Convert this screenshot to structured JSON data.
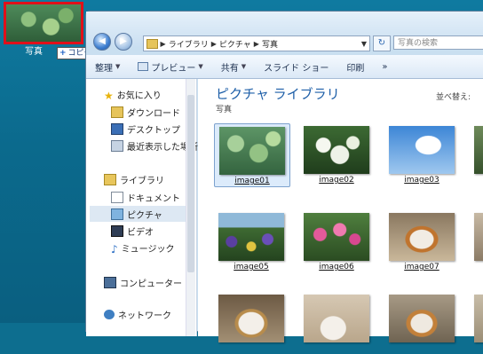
{
  "drag": {
    "label": "写真",
    "badge": "コピー"
  },
  "window": {
    "address": [
      "ライブラリ",
      "ピクチャ",
      "写真"
    ],
    "search_placeholder": "写真の検索",
    "toolbar": [
      "整理",
      "プレビュー",
      "共有",
      "スライド ショー",
      "印刷",
      "»"
    ],
    "nav": {
      "favorites": "お気に入り",
      "downloads": "ダウンロード",
      "desktop": "デスクトップ",
      "recent": "最近表示した場所",
      "libraries": "ライブラリ",
      "documents": "ドキュメント",
      "pictures": "ピクチャ",
      "videos": "ビデオ",
      "music": "ミュージック",
      "computer": "コンピューター",
      "network": "ネットワーク"
    },
    "content": {
      "title": "ピクチャ ライブラリ",
      "subtitle": "写真",
      "sort": "並べ替え:",
      "images": [
        "image01",
        "image02",
        "image03",
        "image05",
        "image06",
        "image07"
      ]
    }
  }
}
